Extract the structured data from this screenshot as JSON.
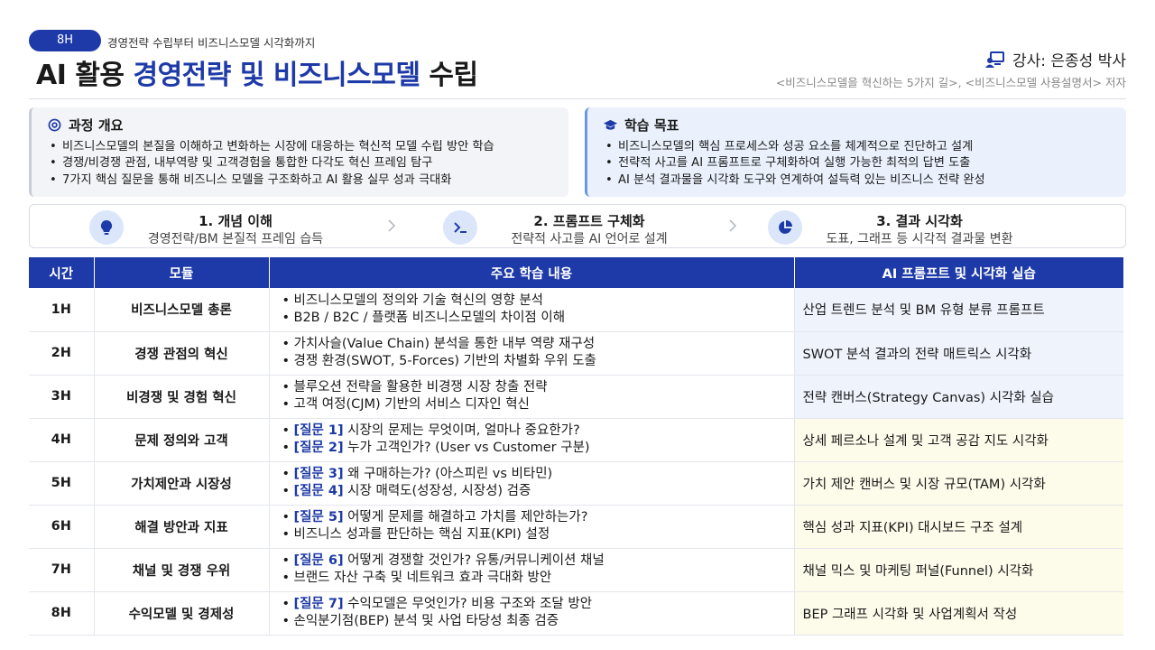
{
  "header": {
    "badge": "8H",
    "subtitle": "경영전략 수립부터 비즈니스모델 시각화까지",
    "title_part1": "AI 활용 ",
    "title_highlight": "경영전략 및 비즈니스모델",
    "title_part2": " 수립",
    "instructor": "강사: 은종성 박사",
    "books": "<비즈니스모델을 혁신하는 5가지 길>, <비즈니스모델 사용설명서> 저자"
  },
  "overview": {
    "title": "과정 개요",
    "items": [
      "비즈니스모델의 본질을 이해하고 변화하는 시장에 대응하는 혁신적 모델 수립 방안 학습",
      "경쟁/비경쟁 관점, 내부역량 및 고객경험을 통합한 다각도 혁신 프레임 탐구",
      "7가지 핵심 질문을 통해 비즈니스 모델을 구조화하고 AI 활용 실무 성과 극대화"
    ]
  },
  "goals": {
    "title": "학습 목표",
    "items": [
      "비즈니스모델의 핵심 프로세스와 성공 요소를 체계적으로 진단하고 설계",
      "전략적 사고를 AI 프롬프트로 구체화하여 실행 가능한 최적의 답변 도출",
      "AI 분석 결과물을 시각화 도구와 연계하여 설득력 있는 비즈니스 전략 완성"
    ]
  },
  "steps": [
    {
      "title": "1. 개념 이해",
      "desc": "경영전략/BM 본질적 프레임 습득",
      "icon": "lightbulb-icon"
    },
    {
      "title": "2. 프롬프트 구체화",
      "desc": "전략적 사고를 AI 언어로 설계",
      "icon": "terminal-icon"
    },
    {
      "title": "3. 결과 시각화",
      "desc": "도표, 그래프 등 시각적 결과물 변환",
      "icon": "pie-chart-icon"
    }
  ],
  "table": {
    "headers": [
      "시간",
      "모듈",
      "주요 학습 내용",
      "AI 프롬프트 및 시각화 실습"
    ],
    "rows": [
      {
        "time": "1H",
        "module": "비즈니스모델 총론",
        "q1": "",
        "c1": "비즈니스모델의 정의와 기술 혁신의 영향 분석",
        "q2": "",
        "c2": "B2B / B2C / 플랫폼 비즈니스모델의 차이점 이해",
        "ai": "산업 트렌드 분석 및 BM 유형 분류 프롬프트"
      },
      {
        "time": "2H",
        "module": "경쟁 관점의 혁신",
        "q1": "",
        "c1": "가치사슬(Value Chain) 분석을 통한 내부 역량 재구성",
        "q2": "",
        "c2": "경쟁 환경(SWOT, 5-Forces) 기반의 차별화 우위 도출",
        "ai": "SWOT 분석 결과의 전략 매트릭스 시각화"
      },
      {
        "time": "3H",
        "module": "비경쟁 및 경험 혁신",
        "q1": "",
        "c1": "블루오션 전략을 활용한 비경쟁 시장 창출 전략",
        "q2": "",
        "c2": "고객 여정(CJM) 기반의 서비스 디자인 혁신",
        "ai": "전략 캔버스(Strategy Canvas) 시각화 실습"
      },
      {
        "time": "4H",
        "module": "문제 정의와 고객",
        "q1": "[질문 1]",
        "c1": " 시장의 문제는 무엇이며, 얼마나 중요한가?",
        "q2": "[질문 2]",
        "c2": " 누가 고객인가? (User vs Customer 구분)",
        "ai": "상세 페르소나 설계 및 고객 공감 지도 시각화"
      },
      {
        "time": "5H",
        "module": "가치제안과 시장성",
        "q1": "[질문 3]",
        "c1": " 왜 구매하는가? (아스피린 vs 비타민)",
        "q2": "[질문 4]",
        "c2": " 시장 매력도(성장성, 시장성) 검증",
        "ai": "가치 제안 캔버스 및 시장 규모(TAM) 시각화"
      },
      {
        "time": "6H",
        "module": "해결 방안과 지표",
        "q1": "[질문 5]",
        "c1": " 어떻게 문제를 해결하고 가치를 제안하는가?",
        "q2": "",
        "c2": "비즈니스 성과를 판단하는 핵심 지표(KPI) 설정",
        "ai": "핵심 성과 지표(KPI) 대시보드 구조 설계"
      },
      {
        "time": "7H",
        "module": "채널 및 경쟁 우위",
        "q1": "[질문 6]",
        "c1": " 어떻게 경쟁할 것인가? 유통/커뮤니케이션 채널",
        "q2": "",
        "c2": "브랜드 자산 구축 및 네트워크 효과 극대화 방안",
        "ai": "채널 믹스 및 마케팅 퍼널(Funnel) 시각화"
      },
      {
        "time": "8H",
        "module": "수익모델 및 경제성",
        "q1": "[질문 7]",
        "c1": " 수익모델은 무엇인가? 비용 구조와 조달 방안",
        "q2": "",
        "c2": "손익분기점(BEP) 분석 및 사업 타당성 최종 검증",
        "ai": "BEP 그래프 시각화 및 사업계획서 작성"
      }
    ]
  },
  "colors": {
    "accent": "#1e3aa8",
    "ai_blue_bg": "#eef3fc",
    "ai_yellow_bg": "#fdfbea"
  }
}
